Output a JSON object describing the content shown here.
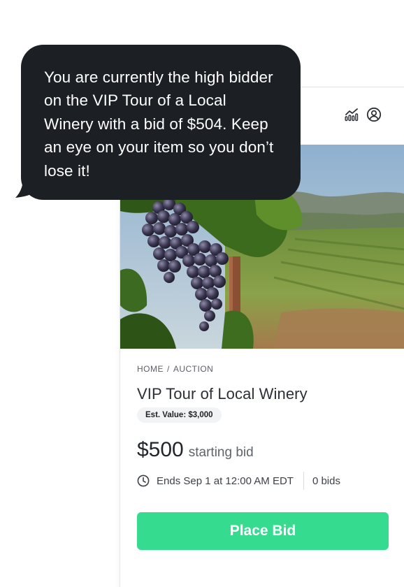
{
  "notification": {
    "message": "You are currently the high bidder on the VIP Tour of a Local Winery with a bid of $504. Keep an eye on your item so you don’t lose it!"
  },
  "topbar": {
    "icons": [
      "analytics-icon",
      "account-icon"
    ]
  },
  "item": {
    "breadcrumb": {
      "home": "HOME",
      "separator": "/",
      "section": "AUCTION"
    },
    "title": "VIP Tour of Local Winery",
    "est_value": "Est. Value: $3,000",
    "price": "$500",
    "price_label": "starting bid",
    "ends": "Ends Sep 1 at 12:00 AM EDT",
    "bids": "0 bids",
    "place_bid_label": "Place Bid"
  },
  "colors": {
    "bubble": "#1c1f24",
    "accent": "#35db8e",
    "text": "#2b2f36"
  }
}
